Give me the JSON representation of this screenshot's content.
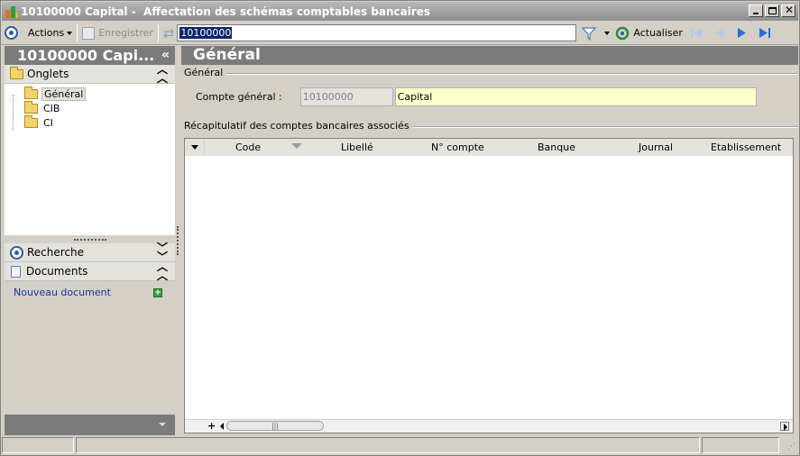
{
  "window": {
    "title": "10100000 Capital -  Affectation des schémas comptables bancaires"
  },
  "toolbar": {
    "actions_label": "Actions",
    "save_label": "Enregistrer",
    "record_id": "10100000",
    "refresh_label": "Actualiser"
  },
  "left": {
    "header": "10100000 Capi...",
    "collapse_glyph": "«",
    "tabs_group": "Onglets",
    "tabs": [
      {
        "label": "Général"
      },
      {
        "label": "CIB"
      },
      {
        "label": "CI"
      }
    ],
    "search_group": "Recherche",
    "documents_group": "Documents",
    "new_document": "Nouveau document"
  },
  "main": {
    "header": "Général",
    "section_general": "Général",
    "compte_label": "Compte général :",
    "compte_value": "10100000",
    "compte_libelle": "Capital",
    "section_recap": "Récapitulatif des comptes bancaires associés",
    "columns": [
      "Code",
      "Libellé",
      "N° compte",
      "Banque",
      "Journal",
      "Etablissement"
    ],
    "rows": [],
    "add_glyph": "+",
    "scroll_thumb": "|||"
  },
  "colors": {
    "header_gray": "#7b7b7b",
    "highlight_field": "#ffffcc",
    "link_blue": "#1b2fa0"
  }
}
